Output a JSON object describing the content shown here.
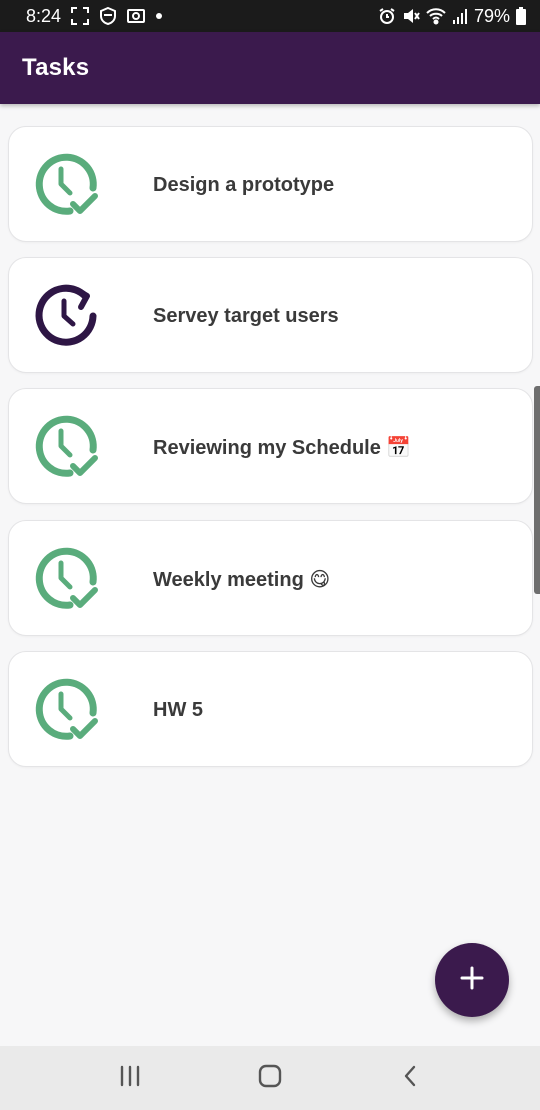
{
  "status_bar": {
    "time": "8:24",
    "battery": "79%",
    "icons": [
      "screen-capture-icon",
      "shield-icon",
      "screenshot-icon",
      "dot-icon",
      "alarm-icon",
      "mute-icon",
      "wifi-icon",
      "signal-icon",
      "battery-icon"
    ]
  },
  "app_bar": {
    "title": "Tasks"
  },
  "tasks": [
    {
      "label": "Design a prototype",
      "status_icon": "clock-check-icon",
      "color": "#5aac7c"
    },
    {
      "label": "Servey target users",
      "status_icon": "clock-refresh-icon",
      "color": "#2e1645"
    },
    {
      "label": "Reviewing my Schedule 📅",
      "status_icon": "clock-check-icon",
      "color": "#5aac7c"
    },
    {
      "label": "Weekly meeting 😋",
      "status_icon": "clock-check-icon",
      "color": "#5aac7c"
    },
    {
      "label": "HW 5",
      "status_icon": "clock-check-icon",
      "color": "#5aac7c"
    }
  ],
  "fab": {
    "icon": "plus-icon"
  },
  "colors": {
    "app_bar": "#3b1a4d",
    "status_done": "#5aac7c",
    "status_pending": "#2e1645"
  },
  "nav_bar": {
    "icons": [
      "recent-apps-icon",
      "home-icon",
      "back-icon"
    ]
  }
}
